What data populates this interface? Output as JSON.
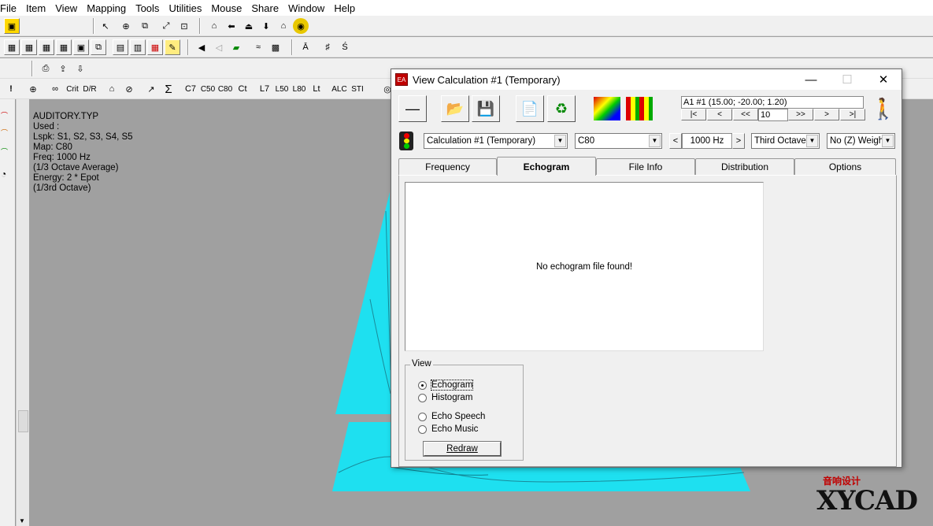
{
  "menu": [
    "File",
    "Item",
    "View",
    "Mapping",
    "Tools",
    "Utilities",
    "Mouse",
    "Share",
    "Window",
    "Help"
  ],
  "toolbar_text": {
    "c7": "C7",
    "c50": "C50",
    "c80": "C80",
    "ct": "Ct",
    "l7": "L7",
    "l50": "L50",
    "l80": "L80",
    "lt": "Lt",
    "alcons": "ALC",
    "sti": "STI",
    "crit": "Crit",
    "dr": "D/R",
    "sigma": "Σ"
  },
  "info_lines": [
    "AUDITORY.TYP",
    "Used :",
    "Lspk: S1, S2, S3, S4, S5",
    "Map: C80",
    "Freq: 1000 Hz",
    "(1/3 Octave Average)",
    "Energy: 2 * Epot",
    "(1/3rd Octave)"
  ],
  "window": {
    "title": "View Calculation #1 (Temporary)",
    "minimize": "—",
    "maximize": "☐",
    "close": "✕",
    "position": "A1 #1  (15.00; -20.00; 1.20)",
    "nav": [
      "|<",
      "<",
      "<<",
      "10",
      ">>",
      ">",
      ">|"
    ],
    "calc_select": "Calculation #1 (Temporary)",
    "param_select": "C80",
    "freq_value": "1000 Hz",
    "band_select": "Third Octave",
    "weight_select": "No (Z) Weigh",
    "tabs": [
      "Frequency",
      "Echogram",
      "File Info",
      "Distribution",
      "Options"
    ],
    "active_tab": "Echogram",
    "message": "No echogram file found!",
    "view_group": {
      "label": "View",
      "options": [
        "Echogram",
        "Histogram",
        "Echo Speech",
        "Echo Music"
      ],
      "selected": "Echogram",
      "redraw": "Redraw"
    }
  },
  "watermark": {
    "cn": "音响设计",
    "en": "XYCAD"
  },
  "colors": {
    "map_cyan": "#1ee0f0",
    "map_teal": "#20b0c0",
    "accent_red": "#c00000"
  }
}
